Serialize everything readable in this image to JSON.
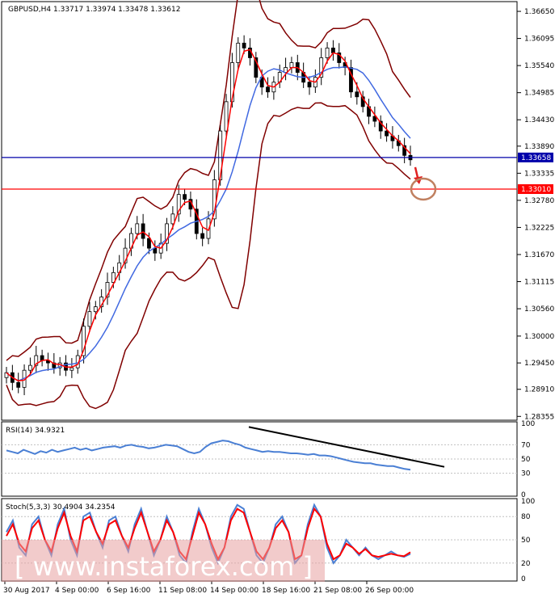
{
  "chart_data": {
    "type": "candlestick",
    "symbol_header": "GBPUSD,H4  1.33717 1.33974 1.33478 1.33612",
    "price_axis": {
      "ticks": [
        "1.36650",
        "1.36095",
        "1.35540",
        "1.34985",
        "1.34430",
        "1.33890",
        "1.33335",
        "1.32780",
        "1.32225",
        "1.31670",
        "1.31115",
        "1.30560",
        "1.30000",
        "1.29450",
        "1.28910",
        "1.28355"
      ],
      "range": [
        1.2831,
        1.368
      ]
    },
    "price_labels": {
      "current": "1.33658",
      "target": "1.33010",
      "current_value": 1.33658,
      "target_value": 1.3301,
      "current_color": "#0000aa",
      "target_color": "#ff0000"
    },
    "x_axis": {
      "labels": [
        "30 Aug 2017",
        "4 Sep 00:00",
        "6 Sep 16:00",
        "11 Sep 08:00",
        "14 Sep 00:00",
        "18 Sep 16:00",
        "21 Sep 08:00",
        "26 Sep 00:00"
      ]
    },
    "close_path": [
      1.2925,
      1.2905,
      1.2895,
      1.293,
      1.294,
      1.296,
      1.295,
      1.2945,
      1.2935,
      1.2945,
      1.293,
      1.2935,
      1.296,
      1.302,
      1.305,
      1.306,
      1.308,
      1.311,
      1.313,
      1.315,
      1.318,
      1.321,
      1.323,
      1.32,
      1.318,
      1.317,
      1.319,
      1.323,
      1.325,
      1.329,
      1.328,
      1.326,
      1.321,
      1.32,
      1.324,
      1.332,
      1.342,
      1.348,
      1.356,
      1.36,
      1.359,
      1.357,
      1.353,
      1.351,
      1.35,
      1.352,
      1.354,
      1.355,
      1.356,
      1.354,
      1.352,
      1.351,
      1.353,
      1.357,
      1.359,
      1.358,
      1.356,
      1.355,
      1.35,
      1.349,
      1.347,
      1.345,
      1.344,
      1.342,
      1.341,
      1.34,
      1.339,
      1.337,
      1.3361
    ],
    "indicators": {
      "bands_color": "#800000",
      "ma_fast_color": "#ff0000",
      "ma_slow_color": "#4169e1",
      "candle_color": "#000000"
    },
    "rsi": {
      "label": "RSI(14) 34.9321",
      "ticks": [
        "100",
        "70",
        "50",
        "30",
        "0"
      ],
      "values": [
        62,
        60,
        58,
        63,
        60,
        57,
        61,
        59,
        63,
        60,
        62,
        64,
        66,
        63,
        65,
        62,
        64,
        66,
        67,
        68,
        66,
        69,
        70,
        68,
        67,
        65,
        66,
        68,
        70,
        69,
        68,
        64,
        60,
        58,
        60,
        67,
        72,
        74,
        76,
        75,
        72,
        70,
        66,
        64,
        62,
        60,
        61,
        60,
        60,
        59,
        58,
        58,
        57,
        56,
        57,
        55,
        55,
        54,
        52,
        50,
        48,
        46,
        45,
        44,
        44,
        42,
        41,
        40,
        40,
        38,
        36,
        35
      ],
      "color": "#4a7fd4",
      "trend_color": "#000000"
    },
    "stoch": {
      "label": "Stoch(5,3,3) 30.4904 34.2354",
      "ticks": [
        "100",
        "80",
        "50",
        "20",
        "0"
      ],
      "k": [
        60,
        75,
        40,
        30,
        70,
        80,
        50,
        30,
        70,
        90,
        50,
        30,
        80,
        85,
        60,
        40,
        75,
        80,
        55,
        35,
        70,
        90,
        60,
        30,
        50,
        80,
        60,
        30,
        20,
        60,
        90,
        70,
        40,
        20,
        40,
        80,
        95,
        90,
        60,
        30,
        20,
        40,
        70,
        80,
        60,
        20,
        30,
        70,
        95,
        80,
        40,
        20,
        30,
        50,
        40,
        30,
        40,
        30,
        25,
        30,
        35,
        30,
        28,
        32
      ],
      "d": [
        55,
        70,
        45,
        35,
        65,
        75,
        50,
        35,
        65,
        85,
        55,
        35,
        75,
        80,
        60,
        45,
        70,
        75,
        55,
        40,
        65,
        85,
        60,
        35,
        50,
        75,
        60,
        35,
        25,
        55,
        85,
        70,
        45,
        25,
        40,
        75,
        90,
        85,
        60,
        35,
        25,
        40,
        65,
        75,
        60,
        25,
        30,
        65,
        90,
        80,
        45,
        25,
        30,
        45,
        40,
        32,
        38,
        30,
        28,
        30,
        32,
        30,
        29,
        34
      ],
      "k_color": "#4a7fd4",
      "d_color": "#ff0000"
    },
    "watermark": "[ www.instaforex.com ]"
  }
}
